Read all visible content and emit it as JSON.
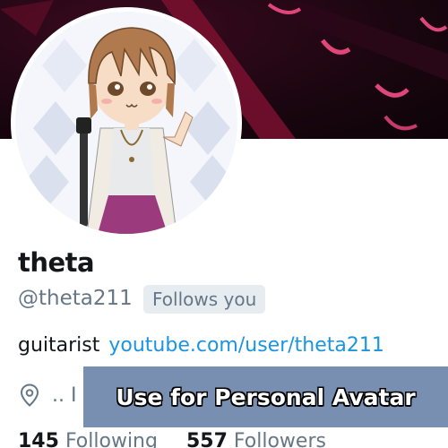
{
  "profile": {
    "display_name": "theta",
    "handle": "@theta211",
    "follows_badge": "Follows you",
    "bio_text": "guitarist",
    "bio_link": "youtube.com/user/theta211",
    "location": ".. I",
    "location_icon": "map-pin-icon"
  },
  "stats": {
    "following_count": "145",
    "following_label": "Following",
    "followers_count": "557",
    "followers_label": "Followers"
  },
  "overlay": {
    "caption": "Use for Personal Avatar"
  },
  "colors": {
    "link": "#1b95e0",
    "muted": "#657786",
    "text": "#14171a",
    "badge_bg": "#e6ecf0",
    "overlay_bg": "#6e86aa"
  }
}
